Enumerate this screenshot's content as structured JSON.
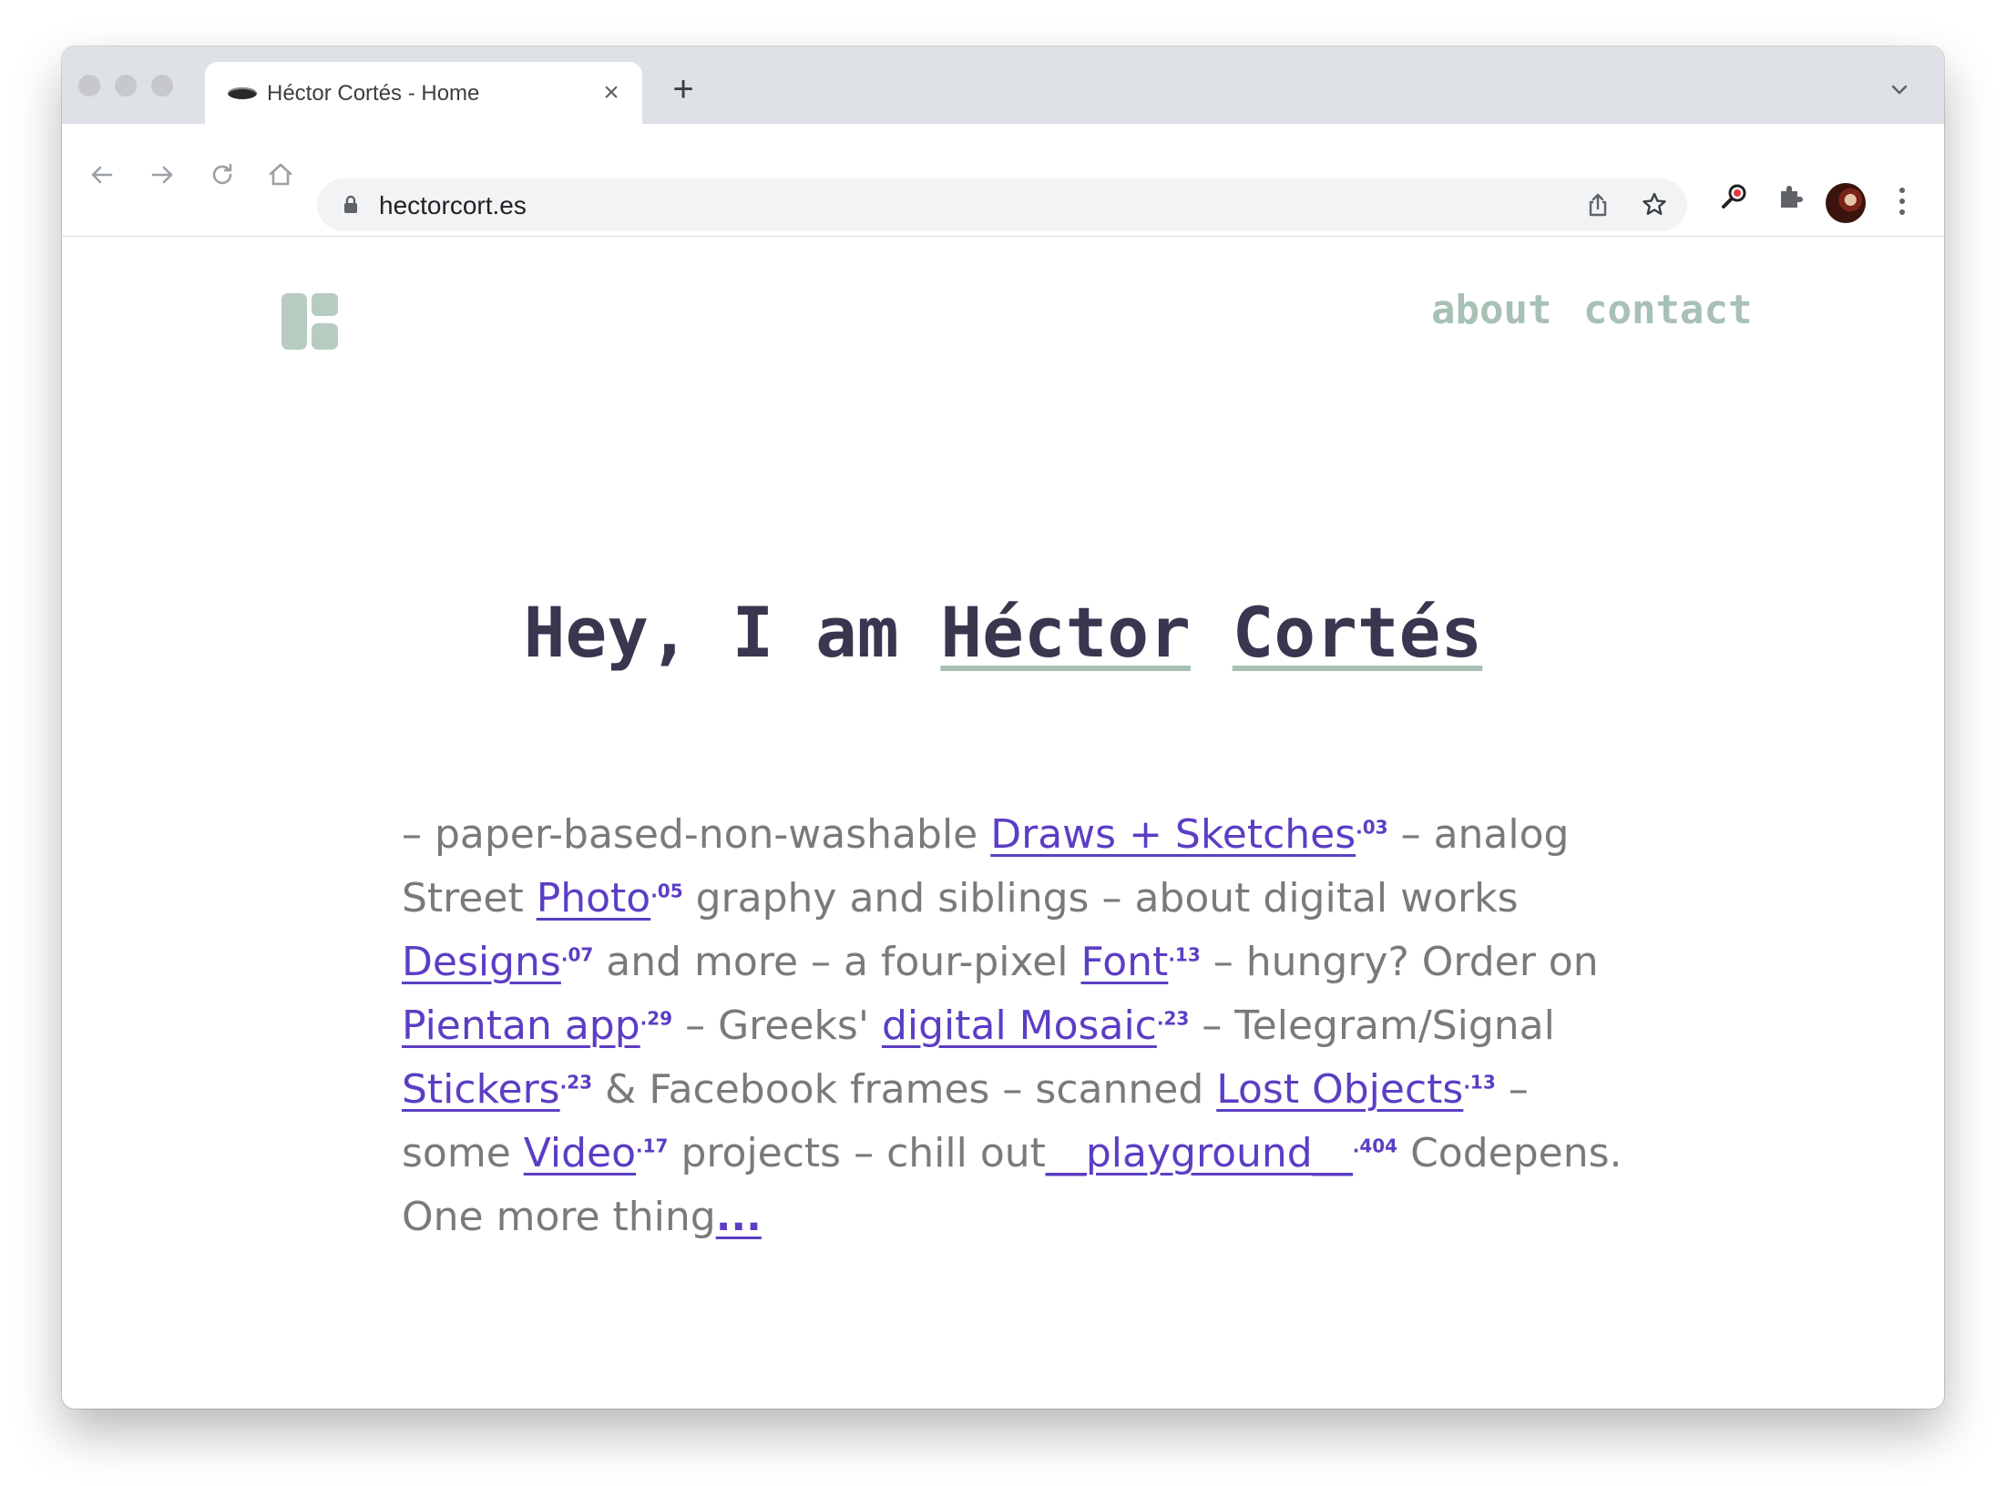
{
  "browser": {
    "tab_title": "Héctor Cortés - Home",
    "tab_close": "×",
    "new_tab": "+",
    "url": "hectorcort.es"
  },
  "site": {
    "nav": {
      "about": "about",
      "contact": "contact"
    },
    "heading": {
      "prefix": "Hey, I am ",
      "first_name": "Héctor",
      "space": " ",
      "last_name": "Cortés"
    },
    "bio": {
      "t1": "– paper-based-non-washable ",
      "l1": "Draws + Sketches",
      "s1": ".03",
      "t2": " – analog Street ",
      "l2": "Photo",
      "s2": ".05",
      "t3": " graphy and siblings – about digital works ",
      "l3": "Designs",
      "s3": ".07",
      "t4": " and more – a four-pixel ",
      "l4": "Font",
      "s4": ".13",
      "t5": " – hungry? Order on ",
      "l5": "Pientan app",
      "s5": ".29",
      "t6": " – Greeks' ",
      "l6": "digital Mosaic",
      "s6": ".23",
      "t7": " – Telegram/Signal ",
      "l7": "Stickers",
      "s7": ".23",
      "t8": " & Facebook frames – scanned ",
      "l8": "Lost Objects",
      "s8": ".13",
      "t9": " – some ",
      "l9": "Video",
      "s9": ".17",
      "t10": " projects – chill out",
      "l10": "__playground__",
      "s10": ".404",
      "t11": " Codepens.",
      "t12": "One more thing",
      "l12": "..."
    }
  },
  "colors": {
    "accent_link": "#5b3ec4",
    "nav_green": "#a7c1b4",
    "heading": "#3b3550",
    "body_text": "#7a7a7a"
  },
  "icons": [
    "back-icon",
    "forward-icon",
    "reload-icon",
    "home-icon",
    "lock-icon",
    "share-icon",
    "star-icon",
    "search-extension-icon",
    "extensions-icon",
    "avatar",
    "menu-icon",
    "tab-search-icon",
    "site-logo"
  ]
}
